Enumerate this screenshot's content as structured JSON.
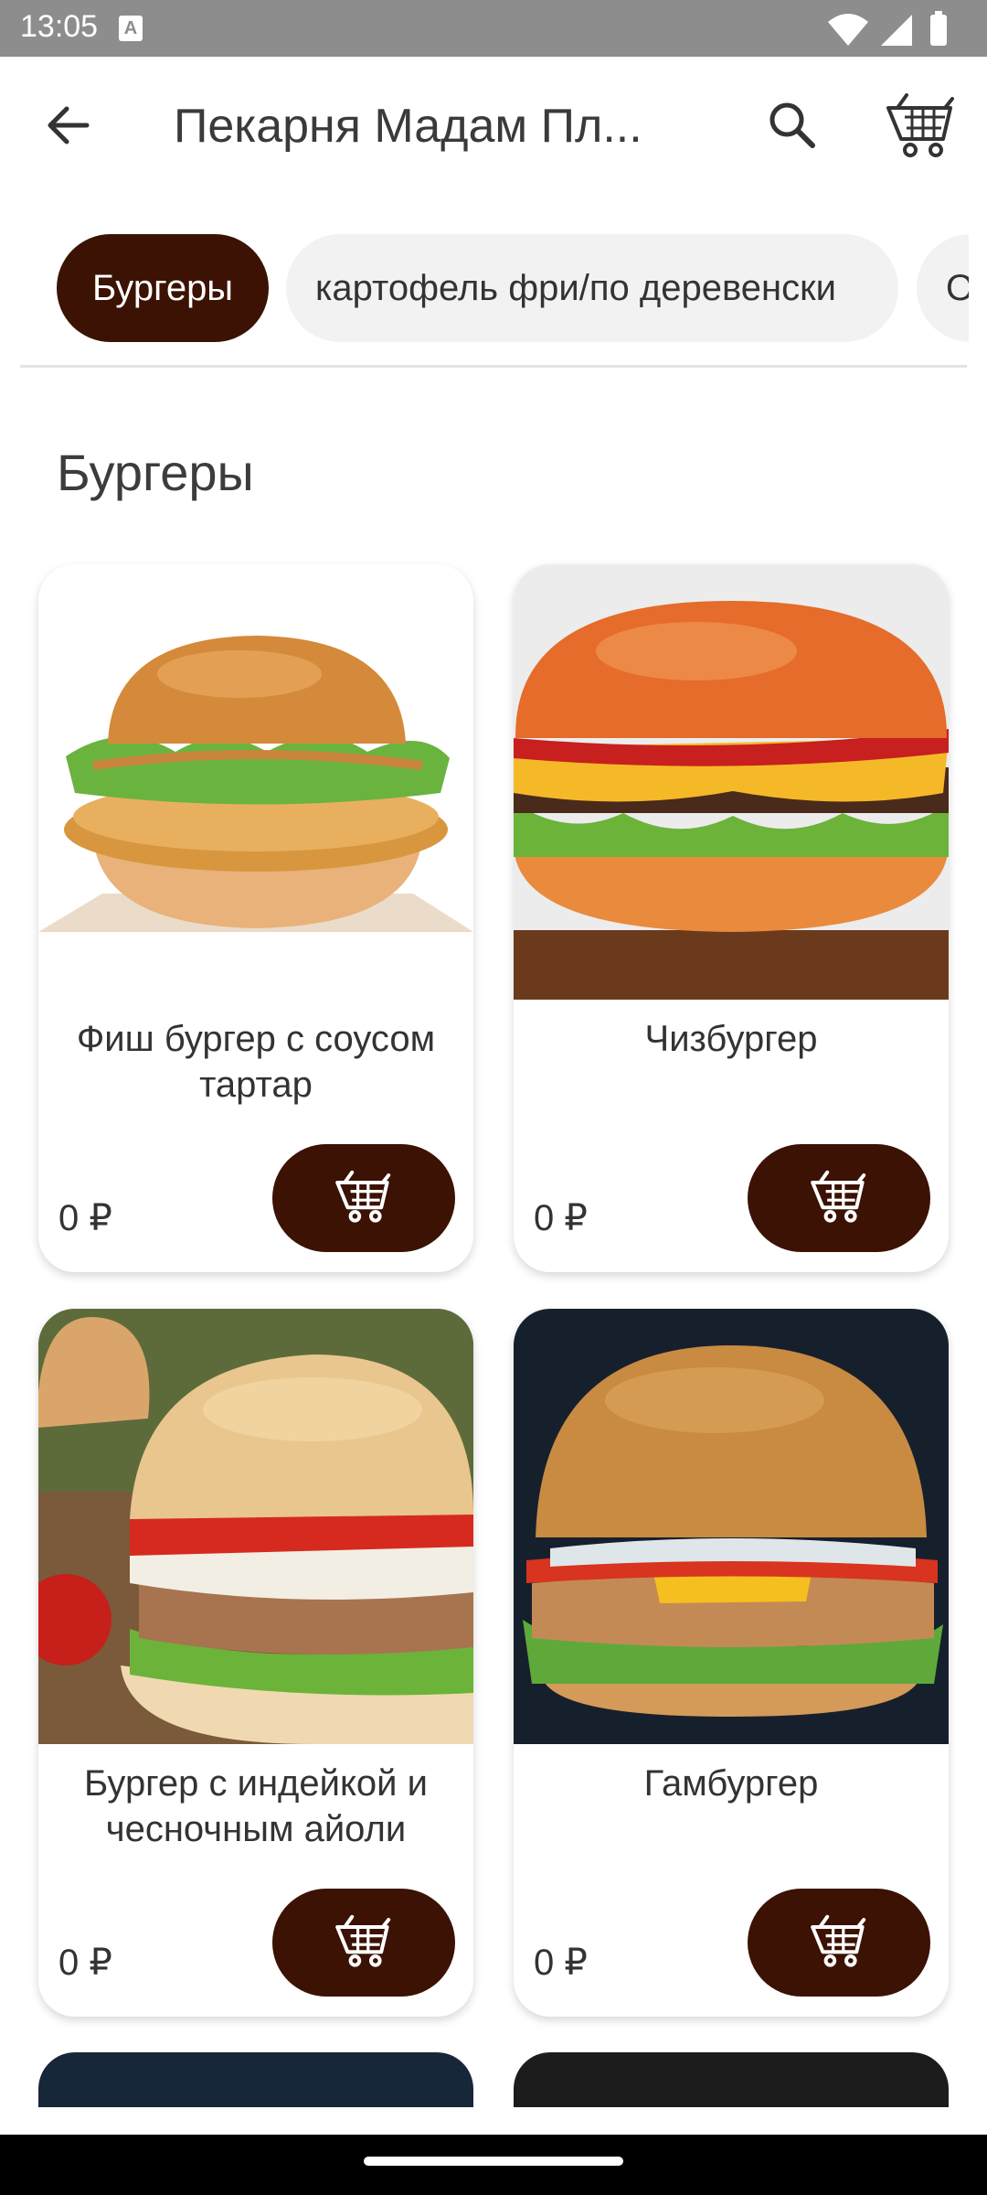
{
  "status_bar": {
    "time": "13:05",
    "notification_letter": "A"
  },
  "app_bar": {
    "title": "Пекарня Мадам Пл...",
    "icons": [
      "arrow-back-icon",
      "search-icon",
      "cart-icon"
    ]
  },
  "categories": [
    {
      "label": "Бургеры",
      "active": true
    },
    {
      "label": "картофель фри/по деревенски",
      "active": false
    },
    {
      "label": "О",
      "active": false
    }
  ],
  "section": {
    "title": "Бургеры"
  },
  "products": [
    {
      "name": "Фиш бургер с соусом тартар",
      "price": "0 ₽"
    },
    {
      "name": "Чизбургер",
      "price": "0 ₽"
    },
    {
      "name": "Бургер с индейкой и чесночным айоли",
      "price": "0 ₽"
    },
    {
      "name": "Гамбургер",
      "price": "0 ₽"
    }
  ],
  "colors": {
    "accent": "#3b1203",
    "chip_inactive": "#f2f2f2",
    "status_bar": "#8d8d8d"
  }
}
